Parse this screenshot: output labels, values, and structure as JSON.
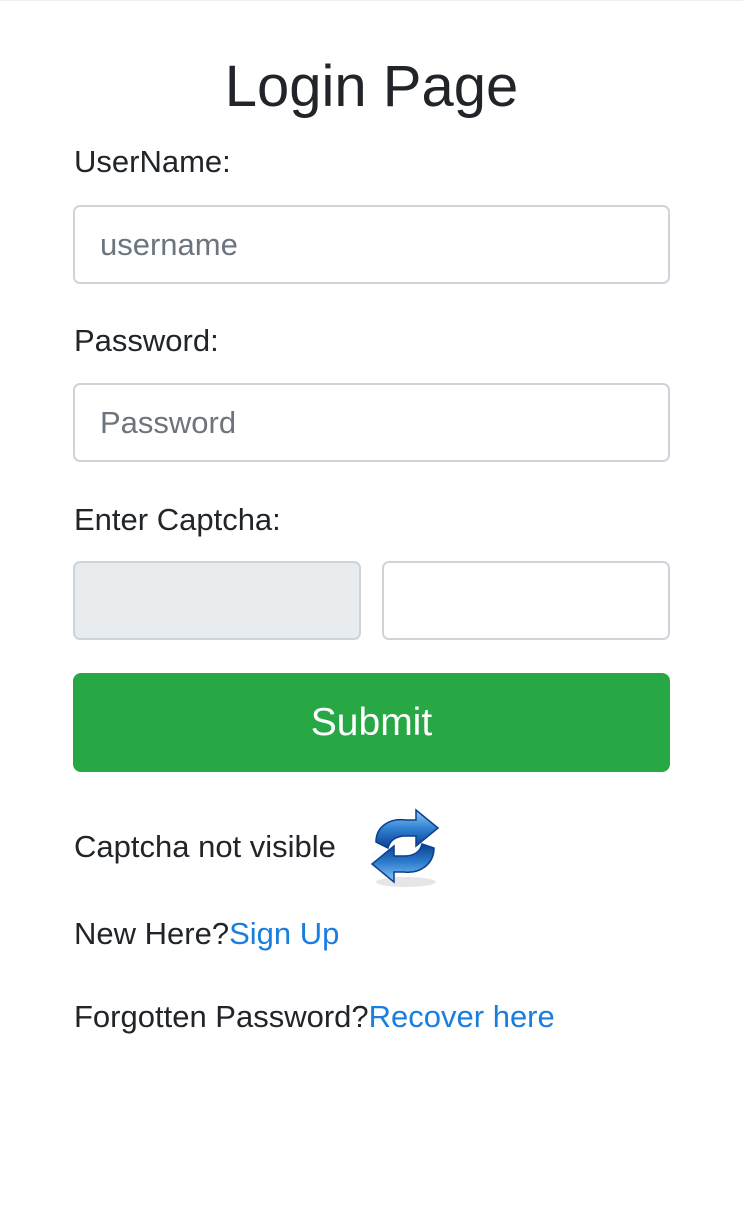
{
  "page": {
    "title": "Login Page"
  },
  "form": {
    "username_label": "UserName:",
    "username_placeholder": "username",
    "username_value": "",
    "password_label": "Password:",
    "password_placeholder": "Password",
    "password_value": "",
    "captcha_label": "Enter Captcha:",
    "captcha_image_value": "",
    "captcha_input_value": "",
    "submit_label": "Submit"
  },
  "footer": {
    "captcha_hint": "Captcha not visible",
    "refresh_icon": "refresh-icon",
    "new_here_text": "New Here?",
    "signup_link": "Sign Up",
    "forgot_text": "Forgotten Password?",
    "recover_link": "Recover here"
  },
  "colors": {
    "submit_bg": "#28a745",
    "link": "#1a7ee0",
    "text": "#212529",
    "border": "#ced4da",
    "readonly_bg": "#e9ecef"
  }
}
